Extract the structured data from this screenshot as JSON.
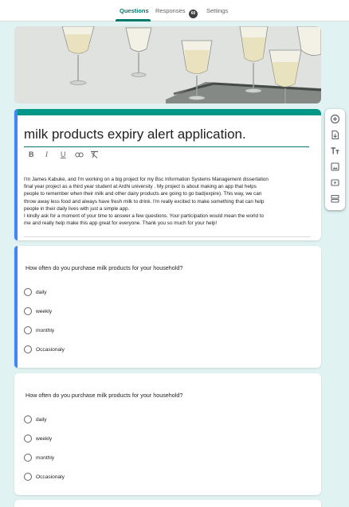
{
  "tabs": {
    "questions": "Questions",
    "responses": "Responses",
    "responses_count": "60",
    "settings": "Settings"
  },
  "form": {
    "title": "milk products expiry alert application.",
    "description_lines": [
      "I'm James Kabuke, and I'm working on a big project for my Bsc Information Systems Management dissertation",
      "final year project as a third year student at Ardhi university . My project is about making an app that helps",
      "people to remember when their milk and other dairy products are going to go bad(expire). This way, we can",
      "throw away less food and always have fresh milk to drink. I'm really excited to make something that can help",
      "people in their daily lives with just a simple app.",
      "I kindly ask for a moment of your time to answer a few questions. Your participation would mean the world to",
      "me and really help make this app great for everyone. Thank you so much for your help!"
    ]
  },
  "format_toolbar": {
    "bold": "B",
    "italic": "I",
    "underline": "U",
    "link": "link-icon",
    "clear": "clear-format-icon"
  },
  "side_toolbar": [
    "add-question-icon",
    "import-questions-icon",
    "add-title-icon",
    "add-image-icon",
    "add-video-icon",
    "add-section-icon"
  ],
  "questions": [
    {
      "text": "How often do you purchase milk products for your household?",
      "options": [
        "daily",
        "weekly",
        "monthly",
        "Occasionaly"
      ]
    },
    {
      "text": "How often do you purchase milk products for your household?",
      "options": [
        "daily",
        "weekly",
        "monthly",
        "Occasionaly"
      ]
    }
  ],
  "colors": {
    "theme": "#009688",
    "accent_blue": "#4285f4",
    "background": "#e0f2f1",
    "tab_active": "#00796b"
  }
}
